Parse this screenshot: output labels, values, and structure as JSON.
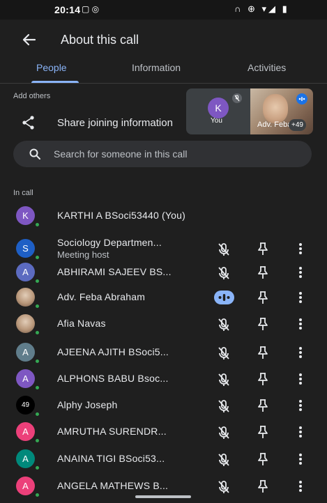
{
  "status_bar": {
    "time": "20:14",
    "left_icons": "▢ ◎",
    "right_icons": "∩ ⊕ ▾◢ ▮"
  },
  "header": {
    "title": "About this call"
  },
  "tabs": [
    {
      "label": "People",
      "active": true
    },
    {
      "label": "Information",
      "active": false
    },
    {
      "label": "Activities",
      "active": false
    }
  ],
  "add_others": {
    "label": "Add others",
    "share_label": "Share joining information"
  },
  "pip": {
    "self_initial": "K",
    "self_label": "You",
    "other_label": "Adv. Feba",
    "overflow_count": "+49"
  },
  "search": {
    "placeholder": "Search for someone in this call"
  },
  "in_call_label": "In call",
  "participants": [
    {
      "name": "KARTHI A BSoci53440 (You)",
      "initial": "K",
      "color": "#7e57c2",
      "actions": false
    },
    {
      "name": "Sociology Departmen...",
      "subtitle": "Meeting host",
      "initial": "S",
      "color": "#1e5fc5",
      "actions": true
    },
    {
      "name": "ABHIRAMI SAJEEV BS...",
      "initial": "A",
      "color": "#5c6bc0",
      "actions": true
    },
    {
      "name": "Adv. Feba Abraham",
      "photo": true,
      "speaking": true,
      "actions": true
    },
    {
      "name": "Afia Navas",
      "photo": true,
      "actions": true
    },
    {
      "name": "AJEENA AJITH BSoci5...",
      "initial": "A",
      "color": "#607d8b",
      "actions": true
    },
    {
      "name": "ALPHONS BABU Bsoc...",
      "initial": "A",
      "color": "#7e57c2",
      "actions": true
    },
    {
      "name": "Alphy Joseph",
      "initial": "49",
      "color": "#000000",
      "actions": true
    },
    {
      "name": "AMRUTHA SURENDR...",
      "initial": "A",
      "color": "#ec407a",
      "actions": true
    },
    {
      "name": "ANAINA TIGI BSoci53...",
      "initial": "A",
      "color": "#00897b",
      "actions": true
    },
    {
      "name": "ANGELA MATHEWS B...",
      "initial": "A",
      "color": "#ec407a",
      "actions": true
    }
  ],
  "colors": {
    "accent": "#8ab4f8",
    "background": "#1f1f1f",
    "presence": "#34a853"
  }
}
